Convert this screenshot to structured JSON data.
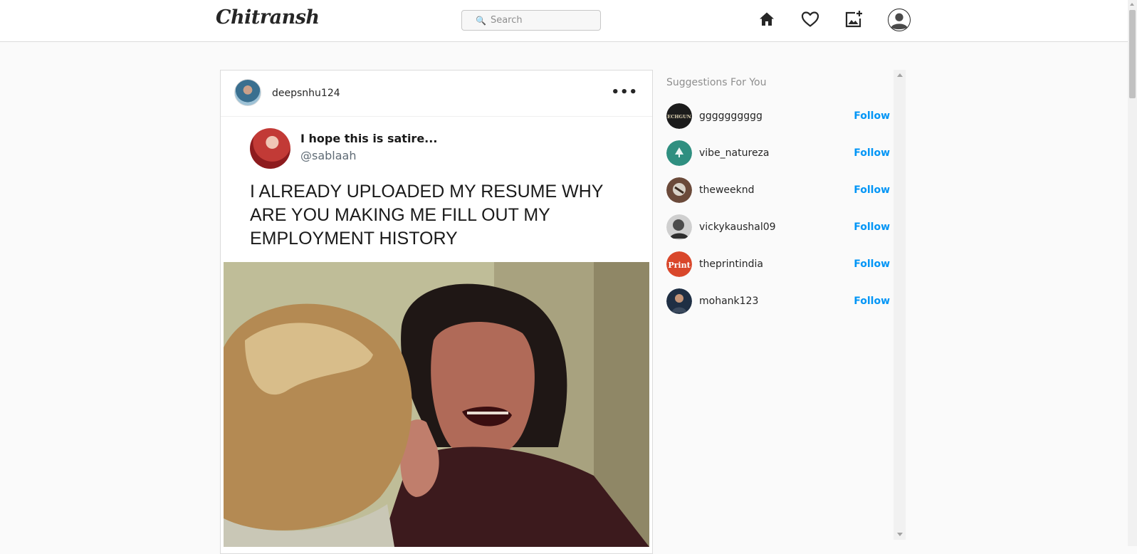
{
  "app": {
    "brand": "Chitransh"
  },
  "search": {
    "placeholder": "Search",
    "icon": "search-icon"
  },
  "nav": {
    "items": [
      {
        "name": "home",
        "icon": "home-icon"
      },
      {
        "name": "activity",
        "icon": "heart-icon"
      },
      {
        "name": "new-post",
        "icon": "add-photo-icon"
      },
      {
        "name": "profile",
        "icon": "avatar-icon"
      }
    ]
  },
  "post": {
    "username": "deepsnhu124",
    "more_label": "•••",
    "tweet": {
      "name": "I hope this is satire...",
      "handle": "@sablaah",
      "text": "I ALREADY UPLOADED MY RESUME WHY ARE YOU MAKING ME FILL OUT MY EMPLOYMENT HISTORY"
    }
  },
  "suggestions": {
    "title": "Suggestions For You",
    "follow_label": "Follow",
    "users": [
      {
        "username": "gggggggggg",
        "avatar_color": "#1c1c1c",
        "avatar_text": "ECHGUN"
      },
      {
        "username": "vibe_natureza",
        "avatar_color": "#2f8f80",
        "avatar_text": ""
      },
      {
        "username": "theweeknd",
        "avatar_color": "#6b4a3a",
        "avatar_text": ""
      },
      {
        "username": "vickykaushal09",
        "avatar_color": "#4b4b4b",
        "avatar_text": ""
      },
      {
        "username": "theprintindia",
        "avatar_color": "#d9472b",
        "avatar_text": "Print"
      },
      {
        "username": "mohank123",
        "avatar_color": "#1f2f44",
        "avatar_text": ""
      }
    ]
  }
}
